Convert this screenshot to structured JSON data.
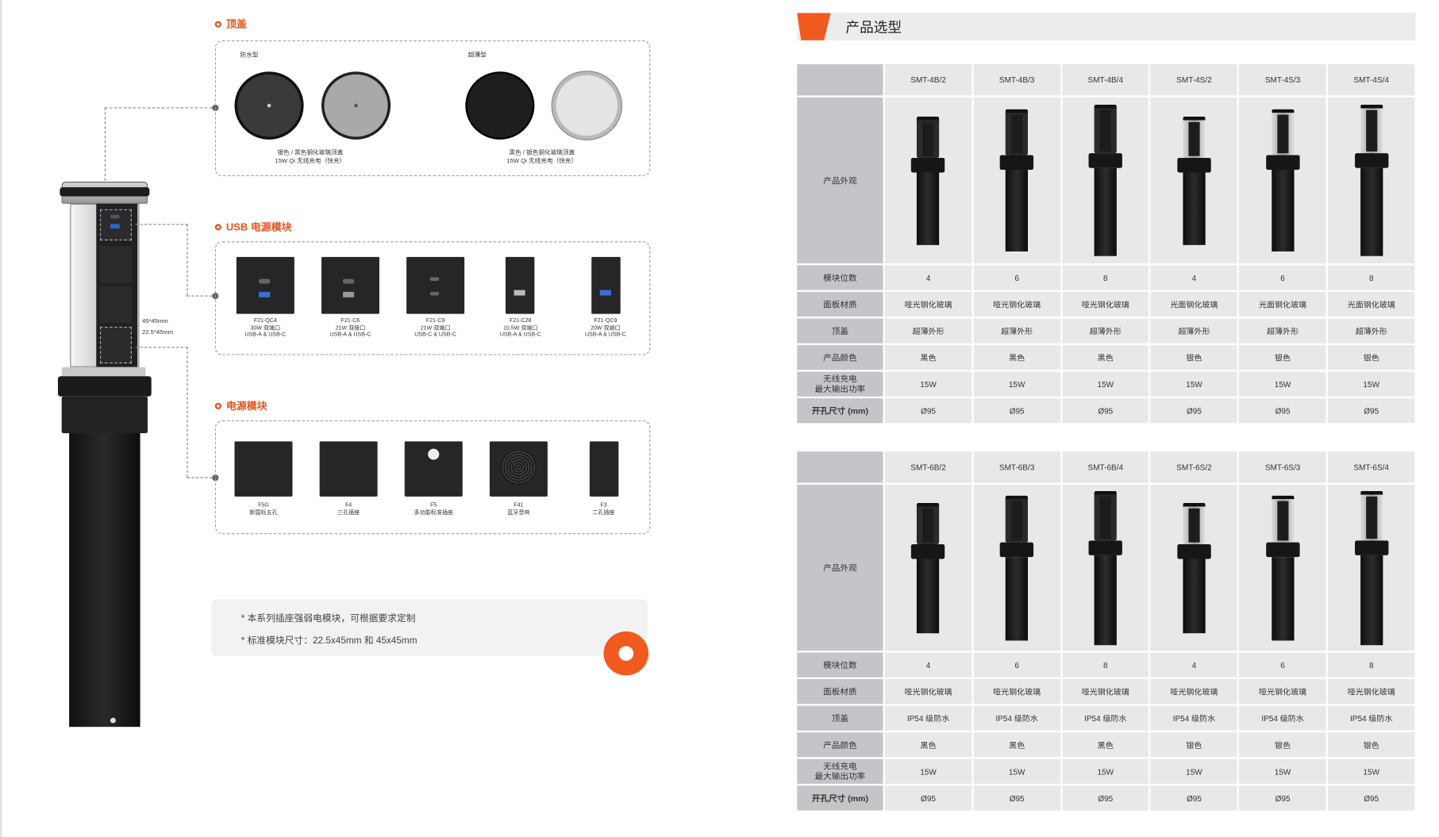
{
  "left": {
    "section_top": "顶盖",
    "section_usb": "USB 电源模块",
    "section_power": "电源模块",
    "top_box": {
      "group1_label": "防水型",
      "group2_label": "超薄型",
      "caption1_line1": "银色 / 黑色钢化玻璃顶盖",
      "caption1_line2": "15W Qi 无线充电（快充）",
      "caption2_line1": "黑色 / 银色钢化玻璃顶盖",
      "caption2_line2": "15W Qi 无线充电（快充）"
    },
    "usb_modules": [
      {
        "code": "F21-QC4",
        "spec": "30W 双端口",
        "ports": "USB-A & USB-C"
      },
      {
        "code": "F21-C6",
        "spec": "21W 双接口",
        "ports": "USB-A & USB-C"
      },
      {
        "code": "F21-C9",
        "spec": "21W 双端口",
        "ports": "USB-C & USB-C"
      },
      {
        "code": "F21-C28",
        "spec": "10.5W 双端口",
        "ports": "USB-A & USB-C"
      },
      {
        "code": "F21-QC9",
        "spec": "20W 双端口",
        "ports": "USB-A & USB-C"
      }
    ],
    "power_modules": [
      {
        "code": "F5G",
        "name": "新国标五孔"
      },
      {
        "code": "F4",
        "name": "三孔插座"
      },
      {
        "code": "F5",
        "name": "多功能标准插座"
      },
      {
        "code": "F41",
        "name": "蓝牙音响"
      },
      {
        "code": "F3",
        "name": "二孔插座"
      }
    ],
    "dim_label_1": "45*45mm",
    "dim_label_2": "22.5*45mm",
    "notes": [
      "* 本系列插座强弱电模块，可根据要求定制",
      "* 标准模块尺寸：22.5x45mm 和 45x45mm"
    ]
  },
  "right": {
    "title": "产品选型",
    "row_labels": {
      "appearance": "产品外观",
      "slots": "模块位数",
      "panel": "面板材质",
      "cover": "顶盖",
      "color": "产品颜色",
      "wireless_line1": "无线充电",
      "wireless_line2": "最大输出功率",
      "cutout": "开孔尺寸 (mm)"
    },
    "table1": {
      "models": [
        "SMT-4B/2",
        "SMT-4B/3",
        "SMT-4B/4",
        "SMT-4S/2",
        "SMT-4S/3",
        "SMT-4S/4"
      ],
      "slots": [
        "4",
        "6",
        "8",
        "4",
        "6",
        "8"
      ],
      "panel": [
        "哑光钢化玻璃",
        "哑光钢化玻璃",
        "哑光钢化玻璃",
        "光面钢化玻璃",
        "光面钢化玻璃",
        "光面钢化玻璃"
      ],
      "cover": [
        "超薄外形",
        "超薄外形",
        "超薄外形",
        "超薄外形",
        "超薄外形",
        "超薄外形"
      ],
      "color": [
        "黑色",
        "黑色",
        "黑色",
        "银色",
        "银色",
        "银色"
      ],
      "wireless": [
        "15W",
        "15W",
        "15W",
        "15W",
        "15W",
        "15W"
      ],
      "cutout": [
        "Ø95",
        "Ø95",
        "Ø95",
        "Ø95",
        "Ø95",
        "Ø95"
      ]
    },
    "table2": {
      "models": [
        "SMT-6B/2",
        "SMT-6B/3",
        "SMT-6B/4",
        "SMT-6S/2",
        "SMT-6S/3",
        "SMT-6S/4"
      ],
      "slots": [
        "4",
        "6",
        "8",
        "4",
        "6",
        "8"
      ],
      "panel": [
        "哑光钢化玻璃",
        "哑光钢化玻璃",
        "哑光钢化玻璃",
        "哑光钢化玻璃",
        "哑光钢化玻璃",
        "哑光钢化玻璃"
      ],
      "cover": [
        "IP54 级防水",
        "IP54 级防水",
        "IP54 级防水",
        "IP54 级防水",
        "IP54 级防水",
        "IP54 级防水"
      ],
      "color": [
        "黑色",
        "黑色",
        "黑色",
        "银色",
        "银色",
        "银色"
      ],
      "wireless": [
        "15W",
        "15W",
        "15W",
        "15W",
        "15W",
        "15W"
      ],
      "cutout": [
        "Ø95",
        "Ø95",
        "Ø95",
        "Ø95",
        "Ø95",
        "Ø95"
      ]
    }
  },
  "colors": {
    "accent": "#e8541c",
    "header_gray": "#c4c5c9",
    "cell_gray": "#e8e8ea",
    "title_bar": "#ececee"
  }
}
